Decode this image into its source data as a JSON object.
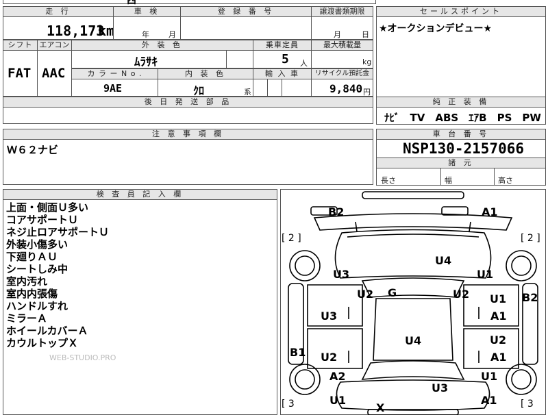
{
  "top": {
    "partial_text": "西"
  },
  "mileage": {
    "header": "走 行",
    "value": "118,173",
    "unit": "km"
  },
  "inspection": {
    "header": "車 検",
    "year_unit": "年",
    "month_unit": "月"
  },
  "registration": {
    "header": "登 録 番 号"
  },
  "transfer": {
    "header": "譲渡書類期限",
    "month_unit": "月",
    "day_unit": "日"
  },
  "sales_point": {
    "header": "セールスポイント",
    "text": "★オークションデビュー★"
  },
  "shift": {
    "header": "シフト",
    "value": "FAT"
  },
  "aircon": {
    "header": "エアコン",
    "value": "AAC"
  },
  "exterior_color": {
    "header": "外 装 色",
    "value": "ﾑﾗｻｷ"
  },
  "capacity": {
    "header": "乗車定員",
    "value": "5",
    "unit": "人"
  },
  "max_load": {
    "header": "最大積載量",
    "unit": "kg"
  },
  "color_no": {
    "header": "カ ラ ー N o .",
    "value": "9AE"
  },
  "interior_color": {
    "header": "内 装 色",
    "value": "ｸﾛ",
    "suffix": "系"
  },
  "import_car": {
    "header": "輸 入 車"
  },
  "recycle": {
    "header": "リサイクル預託金",
    "value": "9,840",
    "unit": "円"
  },
  "later_parts": {
    "header": "後 日 発 送 部 品"
  },
  "equipment": {
    "header": "純 正 装 備",
    "value": "ﾅﾋﾞ　TV　ABS　ｴｱB　PS　PW"
  },
  "notes": {
    "header": "注 意 事 項 欄",
    "text": "Ｗ６２ナビ"
  },
  "chassis": {
    "header": "車 台 番 号",
    "value": "NSP130-2157066"
  },
  "specs": {
    "header": "諸 元",
    "length": "長さ",
    "width": "幅",
    "height": "高さ"
  },
  "inspector": {
    "header": "検 査 員 記 入 欄",
    "lines": [
      "上面・側面Ｕ多い",
      "コアサポートＵ",
      "ネジ止ロアサポートＵ",
      "外装小傷多い",
      "下廻りＡＵ",
      "シートしみ中",
      "室内汚れ",
      "室内内張傷",
      "ハンドルすれ",
      "ミラーＡ",
      "ホイールカバーＡ",
      "カウルトップＸ"
    ],
    "watermark": "WEB-STUDIO.PRO"
  },
  "diagram": {
    "marks": {
      "b2_top": "B2",
      "a1_top": "A1",
      "u4_top": "U4",
      "u3_left": "U3",
      "u1_right": "U1",
      "u2_left": "U2",
      "g": "G",
      "u2_right": "U2",
      "u1_rdoor": "U1",
      "b2_right": "B2",
      "u3_ldoor": "U3",
      "a1_rdoor": "A1",
      "u4_mid": "U4",
      "u2_rdoor": "U2",
      "b1_left": "B1",
      "u2_ldoor": "U2",
      "a1_rdoor2": "A1",
      "a2_left": "A2",
      "u1_rrear": "U1",
      "u3_bottom": "U3",
      "u1_left_bottom": "U1",
      "a1_bottom": "A1",
      "x_bottom": "X"
    },
    "tire_tl": "[ 2 ]",
    "tire_tr": "[ 2 ]",
    "tire_bl": "[ 3",
    "tire_br": "[ 3"
  }
}
